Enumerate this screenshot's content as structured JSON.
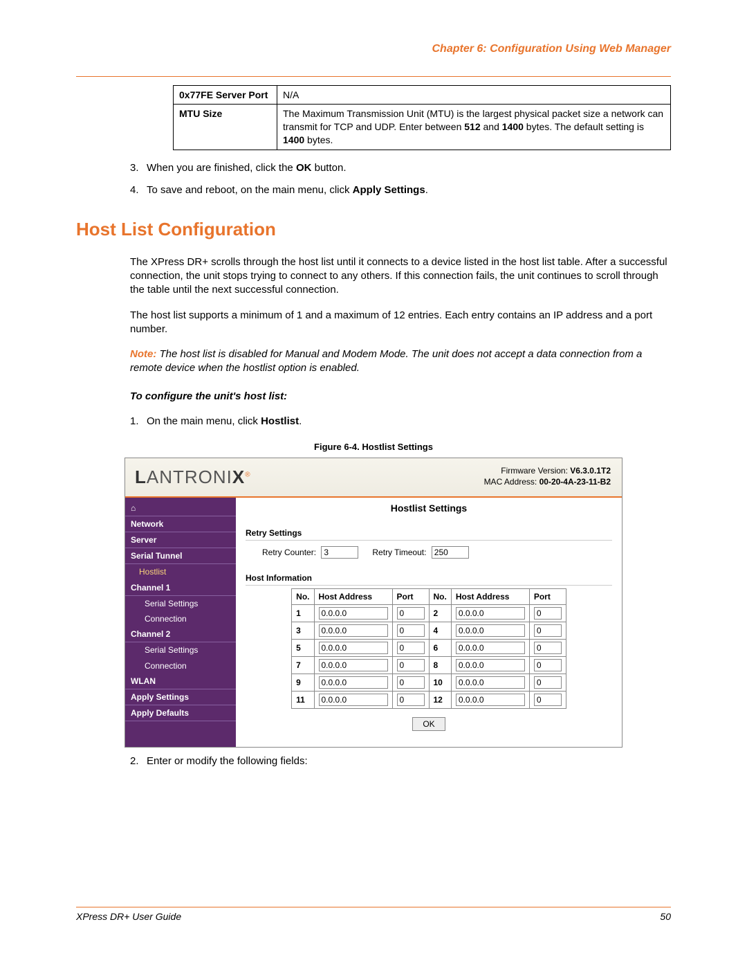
{
  "chapter_header": "Chapter 6: Configuration Using Web Manager",
  "params_table": {
    "rows": [
      {
        "label": "0x77FE Server Port",
        "value_plain": "N/A"
      },
      {
        "label": "MTU Size",
        "value_html_parts": {
          "pre": "The Maximum Transmission Unit (MTU) is the largest physical packet size a network can transmit for TCP and UDP. Enter between ",
          "b1": "512",
          "mid": " and ",
          "b2": "1400",
          "post": " bytes. The default setting is ",
          "b3": "1400",
          "end": " bytes."
        }
      }
    ]
  },
  "steps_top": [
    {
      "num": "3.",
      "pre": "When you are finished, click the ",
      "bold1": "OK",
      "post": " button."
    },
    {
      "num": "4.",
      "pre": "To save and reboot, on the main menu, click ",
      "bold1": "Apply Settings",
      "post": "."
    }
  ],
  "section_heading": "Host List Configuration",
  "para1": "The XPress DR+ scrolls through the host list until it connects to a device listed in the host list table. After a successful connection, the unit stops trying to connect to any others. If this connection fails, the unit continues to scroll through the table until the next successful connection.",
  "para2": "The host list supports a minimum of 1 and a maximum of 12 entries. Each entry contains an IP address and a port number.",
  "note": {
    "label": "Note:",
    "text": " The host list is disabled for Manual and Modem Mode. The unit does not accept a data connection from a remote device when the hostlist option is enabled."
  },
  "sub_heading": "To configure the unit's host list:",
  "steps_mid": [
    {
      "num": "1.",
      "pre": "On the main menu, click ",
      "bold1": "Hostlist",
      "post": "."
    }
  ],
  "figure_caption": "Figure 6-4. Hostlist Settings",
  "webmgr": {
    "logo_black": "L",
    "logo_rest": "ANTRONI",
    "logo_end": "X",
    "fw_label": "Firmware Version:",
    "fw_value": "V6.3.0.1T2",
    "mac_label": "MAC Address:",
    "mac_value": "00-20-4A-23-11-B2",
    "title": "Hostlist Settings",
    "sidebar": [
      {
        "label": "Network",
        "type": "head"
      },
      {
        "label": "Server",
        "type": "head"
      },
      {
        "label": "Serial Tunnel",
        "type": "head"
      },
      {
        "label": "Hostlist",
        "type": "sub",
        "sel": true
      },
      {
        "label": "Channel 1",
        "type": "head"
      },
      {
        "label": "Serial Settings",
        "type": "subsub"
      },
      {
        "label": "Connection",
        "type": "subsub"
      },
      {
        "label": "Channel 2",
        "type": "head"
      },
      {
        "label": "Serial Settings",
        "type": "subsub"
      },
      {
        "label": "Connection",
        "type": "subsub"
      },
      {
        "label": "WLAN",
        "type": "head"
      },
      {
        "label": "Apply Settings",
        "type": "head"
      },
      {
        "label": "Apply Defaults",
        "type": "head"
      }
    ],
    "retry_section": "Retry Settings",
    "retry_counter_label": "Retry Counter:",
    "retry_counter_value": "3",
    "retry_timeout_label": "Retry Timeout:",
    "retry_timeout_value": "250",
    "host_info_section": "Host Information",
    "host_headers": {
      "no": "No.",
      "addr": "Host Address",
      "port": "Port"
    },
    "hosts": [
      {
        "no": "1",
        "addr": "0.0.0.0",
        "port": "0"
      },
      {
        "no": "2",
        "addr": "0.0.0.0",
        "port": "0"
      },
      {
        "no": "3",
        "addr": "0.0.0.0",
        "port": "0"
      },
      {
        "no": "4",
        "addr": "0.0.0.0",
        "port": "0"
      },
      {
        "no": "5",
        "addr": "0.0.0.0",
        "port": "0"
      },
      {
        "no": "6",
        "addr": "0.0.0.0",
        "port": "0"
      },
      {
        "no": "7",
        "addr": "0.0.0.0",
        "port": "0"
      },
      {
        "no": "8",
        "addr": "0.0.0.0",
        "port": "0"
      },
      {
        "no": "9",
        "addr": "0.0.0.0",
        "port": "0"
      },
      {
        "no": "10",
        "addr": "0.0.0.0",
        "port": "0"
      },
      {
        "no": "11",
        "addr": "0.0.0.0",
        "port": "0"
      },
      {
        "no": "12",
        "addr": "0.0.0.0",
        "port": "0"
      }
    ],
    "ok_label": "OK"
  },
  "steps_after": [
    {
      "num": "2.",
      "text": "Enter or modify the following fields:"
    }
  ],
  "footer": {
    "left": "XPress DR+ User Guide",
    "right": "50"
  }
}
